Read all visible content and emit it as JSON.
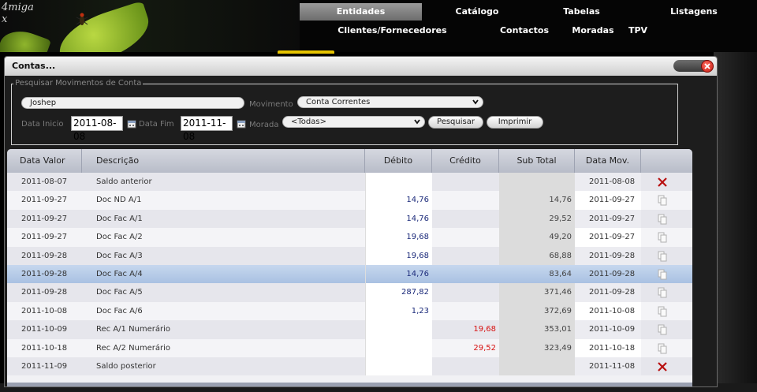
{
  "app": {
    "logo_text": "4miga\nx"
  },
  "nav": {
    "main": [
      "Entidades",
      "Catálogo",
      "Tabelas",
      "Listagens"
    ],
    "sub": [
      "Clientes/Fornecedores",
      "Contactos",
      "Moradas",
      "TPV"
    ]
  },
  "dialog": {
    "title": "Contas...",
    "search": {
      "legend": "Pesquisar Movimentos de Conta",
      "entity_value": "Joshep",
      "movimento_label": "Movimento",
      "movimento_value": "Conta Correntes",
      "data_inicio_label": "Data Inicio",
      "data_inicio_value": "2011-08-08",
      "data_fim_label": "Data Fim",
      "data_fim_value": "2011-11-08",
      "morada_label": "Morada",
      "morada_value": "<Todas>",
      "pesquisar_label": "Pesquisar",
      "imprimir_label": "Imprimir"
    },
    "grid": {
      "columns": [
        "Data Valor",
        "Descrição",
        "Débito",
        "Crédito",
        "Sub Total",
        "Data Mov."
      ],
      "rows": [
        {
          "data_valor": "2011-08-07",
          "descricao": "Saldo anterior",
          "debito": "",
          "credito": "",
          "sub_total": "",
          "data_mov": "2011-08-08",
          "action": "delete"
        },
        {
          "data_valor": "2011-09-27",
          "descricao": "Doc ND A/1",
          "debito": "14,76",
          "credito": "",
          "sub_total": "14,76",
          "data_mov": "2011-09-27",
          "action": "copy"
        },
        {
          "data_valor": "2011-09-27",
          "descricao": "Doc Fac A/1",
          "debito": "14,76",
          "credito": "",
          "sub_total": "29,52",
          "data_mov": "2011-09-27",
          "action": "copy"
        },
        {
          "data_valor": "2011-09-27",
          "descricao": "Doc Fac A/2",
          "debito": "19,68",
          "credito": "",
          "sub_total": "49,20",
          "data_mov": "2011-09-27",
          "action": "copy"
        },
        {
          "data_valor": "2011-09-28",
          "descricao": "Doc Fac A/3",
          "debito": "19,68",
          "credito": "",
          "sub_total": "68,88",
          "data_mov": "2011-09-28",
          "action": "copy"
        },
        {
          "data_valor": "2011-09-28",
          "descricao": "Doc Fac A/4",
          "debito": "14,76",
          "credito": "",
          "sub_total": "83,64",
          "data_mov": "2011-09-28",
          "action": "copy",
          "selected": true
        },
        {
          "data_valor": "2011-09-28",
          "descricao": "Doc Fac A/5",
          "debito": "287,82",
          "credito": "",
          "sub_total": "371,46",
          "data_mov": "2011-09-28",
          "action": "copy"
        },
        {
          "data_valor": "2011-10-08",
          "descricao": "Doc Fac A/6",
          "debito": "1,23",
          "credito": "",
          "sub_total": "372,69",
          "data_mov": "2011-10-08",
          "action": "copy"
        },
        {
          "data_valor": "2011-10-09",
          "descricao": "Rec A/1 Numerário",
          "debito": "",
          "credito": "19,68",
          "sub_total": "353,01",
          "data_mov": "2011-10-09",
          "action": "copy"
        },
        {
          "data_valor": "2011-10-18",
          "descricao": "Rec A/2 Numerário",
          "debito": "",
          "credito": "29,52",
          "sub_total": "323,49",
          "data_mov": "2011-10-18",
          "action": "copy"
        },
        {
          "data_valor": "2011-11-09",
          "descricao": "Saldo posterior",
          "debito": "",
          "credito": "",
          "sub_total": "",
          "data_mov": "2011-11-08",
          "action": "delete"
        }
      ]
    }
  },
  "colors": {
    "debit": "#1b2a7a",
    "credit": "#d71010",
    "delete_icon": "#b81010",
    "selected_row": "#b4c9e7"
  },
  "icons": {
    "close": "close-icon",
    "calendar": "calendar-icon",
    "dropdown": "chevron-down-icon",
    "delete": "delete-x-icon",
    "copy": "copy-icon"
  }
}
